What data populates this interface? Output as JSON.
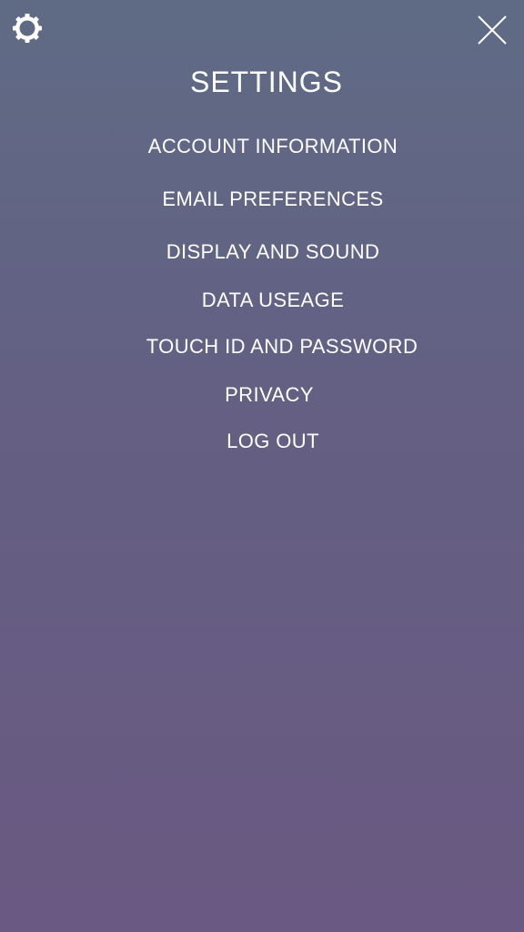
{
  "header": {
    "title": "SETTINGS",
    "settings_icon": "gear-icon",
    "close_icon": "close-icon"
  },
  "menu": {
    "items": [
      {
        "label": "ACCOUNT INFORMATION"
      },
      {
        "label": "EMAIL PREFERENCES"
      },
      {
        "label": "DISPLAY AND SOUND"
      },
      {
        "label": "DATA USEAGE"
      },
      {
        "label": "TOUCH ID AND PASSWORD"
      },
      {
        "label": "PRIVACY"
      },
      {
        "label": "LOG OUT"
      }
    ]
  },
  "colors": {
    "background_top": "#5f6b85",
    "background_bottom": "#6a5982",
    "text": "#ffffff"
  }
}
